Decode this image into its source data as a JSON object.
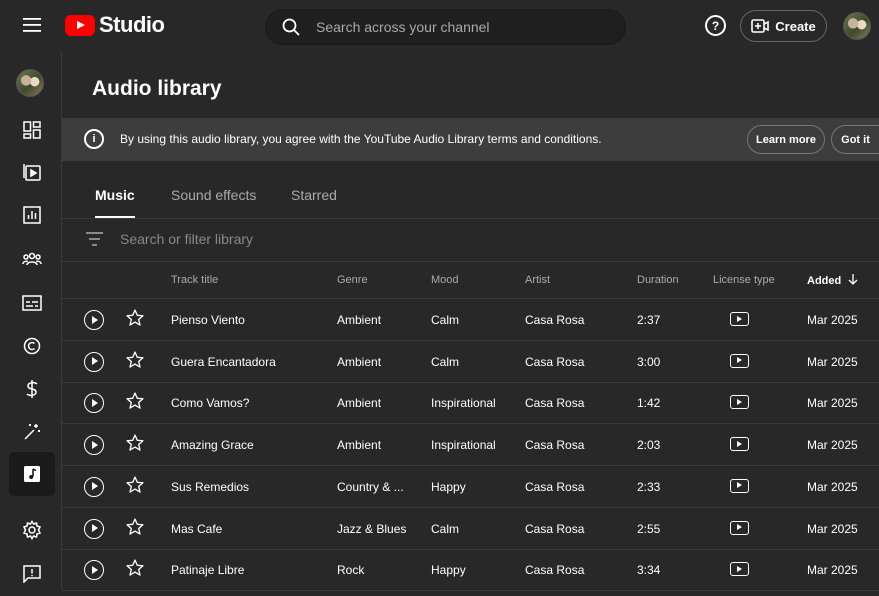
{
  "header": {
    "logo_text": "Studio",
    "search_placeholder": "Search across your channel",
    "create_label": "Create"
  },
  "sidebar": {
    "items": [
      {
        "name": "dashboard-icon"
      },
      {
        "name": "content-icon"
      },
      {
        "name": "analytics-icon"
      },
      {
        "name": "community-icon"
      },
      {
        "name": "subtitles-icon"
      },
      {
        "name": "copyright-icon"
      },
      {
        "name": "earn-icon"
      },
      {
        "name": "customization-icon"
      },
      {
        "name": "audio-library-icon"
      },
      {
        "name": "settings-icon"
      },
      {
        "name": "feedback-icon"
      }
    ]
  },
  "page": {
    "title": "Audio library",
    "banner_text": "By using this audio library, you agree with the YouTube Audio Library terms and conditions.",
    "learn_more": "Learn more",
    "got_it": "Got it",
    "tabs": [
      "Music",
      "Sound effects",
      "Starred"
    ],
    "filter_placeholder": "Search or filter library"
  },
  "table": {
    "headers": {
      "title": "Track title",
      "genre": "Genre",
      "mood": "Mood",
      "artist": "Artist",
      "duration": "Duration",
      "license": "License type",
      "added": "Added"
    },
    "rows": [
      {
        "title": "Pienso Viento",
        "genre": "Ambient",
        "mood": "Calm",
        "artist": "Casa Rosa",
        "duration": "2:37",
        "added": "Mar 2025"
      },
      {
        "title": "Guera Encantadora",
        "genre": "Ambient",
        "mood": "Calm",
        "artist": "Casa Rosa",
        "duration": "3:00",
        "added": "Mar 2025"
      },
      {
        "title": "Como Vamos?",
        "genre": "Ambient",
        "mood": "Inspirational",
        "artist": "Casa Rosa",
        "duration": "1:42",
        "added": "Mar 2025"
      },
      {
        "title": "Amazing Grace",
        "genre": "Ambient",
        "mood": "Inspirational",
        "artist": "Casa Rosa",
        "duration": "2:03",
        "added": "Mar 2025"
      },
      {
        "title": "Sus Remedios",
        "genre": "Country & ...",
        "mood": "Happy",
        "artist": "Casa Rosa",
        "duration": "2:33",
        "added": "Mar 2025"
      },
      {
        "title": "Mas Cafe",
        "genre": "Jazz & Blues",
        "mood": "Calm",
        "artist": "Casa Rosa",
        "duration": "2:55",
        "added": "Mar 2025"
      },
      {
        "title": "Patinaje Libre",
        "genre": "Rock",
        "mood": "Happy",
        "artist": "Casa Rosa",
        "duration": "3:34",
        "added": "Mar 2025"
      }
    ]
  },
  "colors": {
    "background": "#282828",
    "banner": "#3d3d3d",
    "brand_red": "#ff0000"
  }
}
